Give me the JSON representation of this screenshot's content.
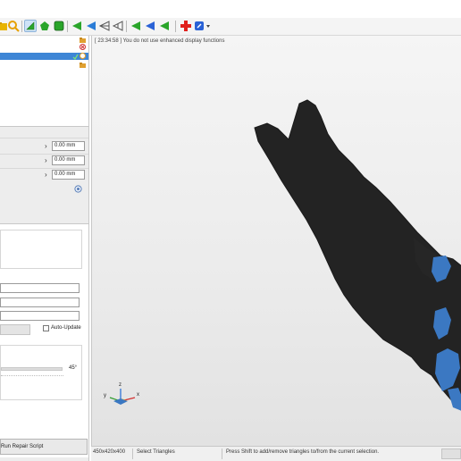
{
  "toolbar": {
    "buttons": [
      {
        "icon": "folder-icon",
        "color": "#e8b400"
      },
      {
        "icon": "magnify-icon",
        "color": "#e6a000"
      },
      {
        "icon": "select-triangle-icon",
        "color": "#2aa52a",
        "active": true
      },
      {
        "icon": "select-brush-icon",
        "color": "#2aa52a"
      },
      {
        "icon": "select-shell-icon",
        "color": "#2aa52a"
      },
      {
        "icon": "select-all-icon",
        "color": "#2aa52a"
      },
      {
        "icon": "invert-selection-icon",
        "color": "#2a7cd6"
      },
      {
        "icon": "wire-triangle-icon",
        "color": "#555555"
      },
      {
        "icon": "wire-triangle-alt-icon",
        "color": "#555555"
      },
      {
        "icon": "grow-selection-icon",
        "color": "#2aa52a"
      },
      {
        "icon": "shrink-selection-icon",
        "color": "#2a62d6"
      },
      {
        "icon": "border-selection-icon",
        "color": "#2aa52a"
      },
      {
        "icon": "add-part-icon",
        "color": "#e0201c"
      },
      {
        "icon": "repair-dropdown-icon",
        "color": "#2a62d6"
      }
    ]
  },
  "log": {
    "message": "[ 23:34:58 ] You do not use enhanced display functions"
  },
  "parameters": {
    "x": "0.00 mm",
    "y": "0.00 mm",
    "z": "0.00 mm"
  },
  "repair": {
    "auto_update_label": "Auto-Update",
    "angle_value": "45°",
    "run_script_label": "Run Repair Script"
  },
  "axes": {
    "x": "x",
    "y": "y",
    "z": "z"
  },
  "status": {
    "dimensions": "450x420x400",
    "mode": "Select Triangles",
    "hint": "Press Shift to add/remove triangles to/from the current selection."
  },
  "colors": {
    "mesh": "#232323",
    "selected_triangles": "#3b78c2",
    "tree_selection": "#3e86d6"
  }
}
